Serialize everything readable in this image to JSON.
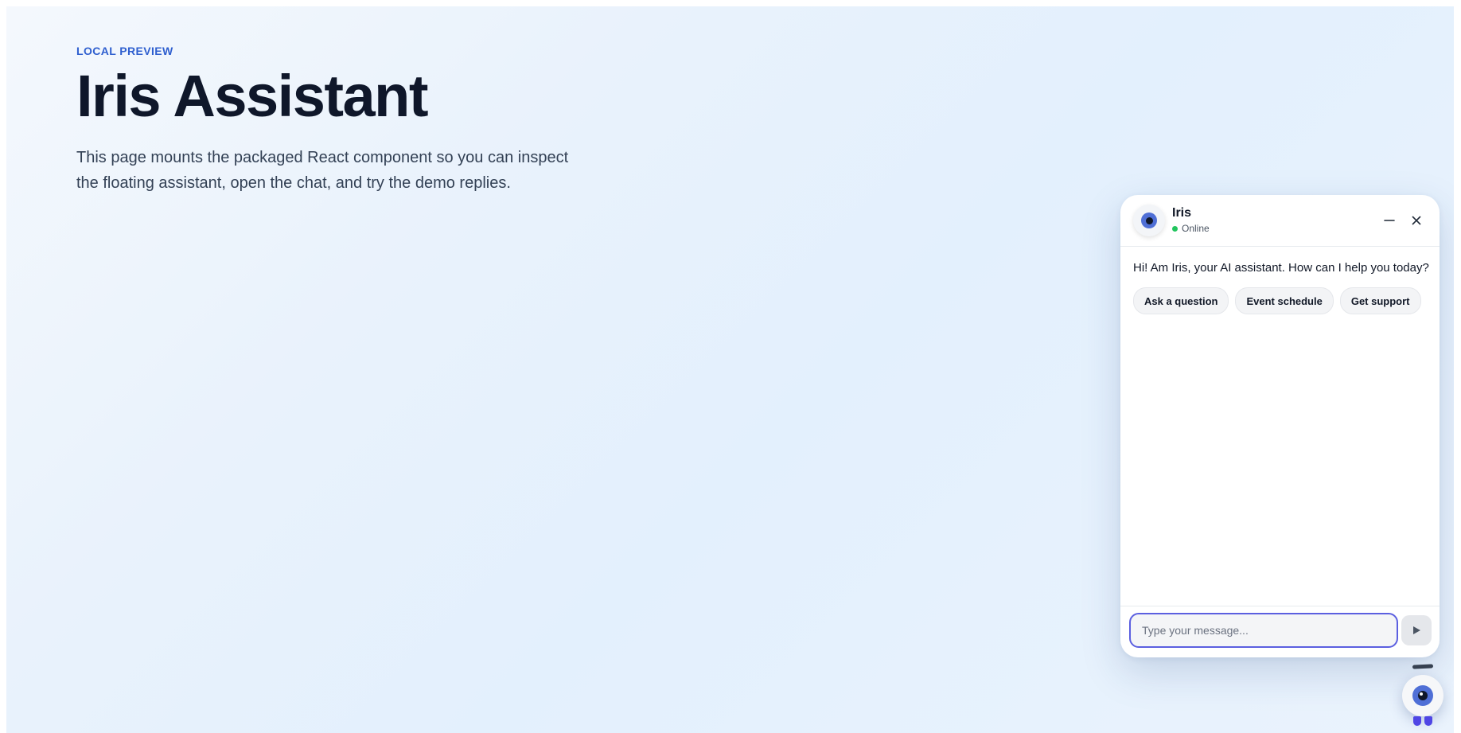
{
  "hero": {
    "eyebrow": "LOCAL PREVIEW",
    "title": "Iris Assistant",
    "description": "This page mounts the packaged React component so you can inspect the floating assistant, open the chat, and try the demo replies."
  },
  "chat": {
    "bot_name": "Iris",
    "status": "Online",
    "status_color": "#22c55e",
    "minimize_icon": "minimize-icon",
    "close_icon": "close-icon",
    "greeting": "Hi! Am Iris, your AI assistant. How can I help you today?",
    "quick_replies": [
      {
        "label": "Ask a question"
      },
      {
        "label": "Event schedule"
      },
      {
        "label": "Get support"
      }
    ],
    "input": {
      "value": "",
      "placeholder": "Type your message..."
    },
    "send_icon": "play-icon"
  },
  "colors": {
    "accent": "#2f5fcf",
    "input_focus": "#5b5fe0",
    "eye": "#4f6fd6",
    "feet": "#4f46e5"
  }
}
